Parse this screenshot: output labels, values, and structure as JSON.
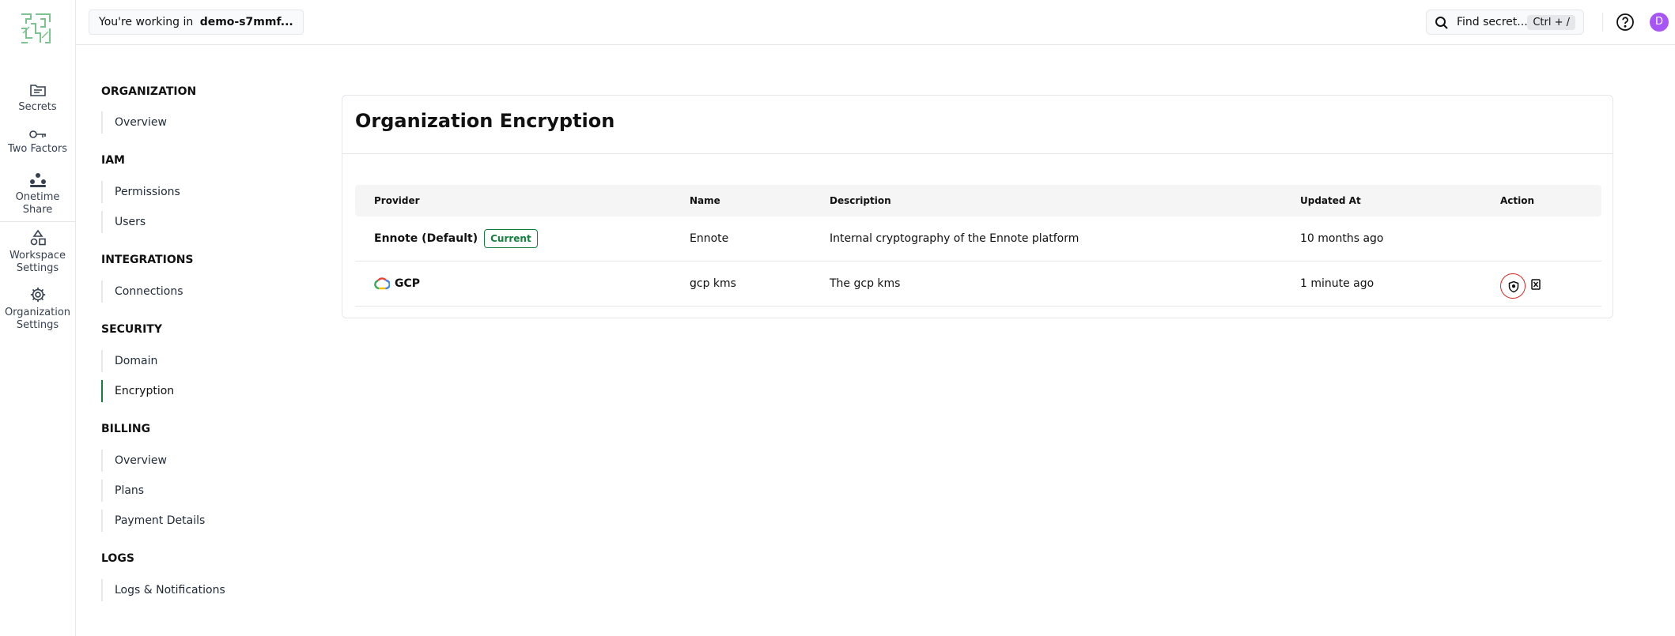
{
  "rail": {
    "items": [
      {
        "label": "Secrets",
        "icon": "folder-icon"
      },
      {
        "label": "Two Factors",
        "icon": "key-icon"
      },
      {
        "label": "Onetime",
        "label2": "Share",
        "icon": "share-nodes-icon"
      },
      {
        "label": "Workspace",
        "label2": "Settings",
        "icon": "shapes-icon"
      },
      {
        "label": "Organization",
        "label2": "Settings",
        "icon": "gear-icon"
      }
    ]
  },
  "topbar": {
    "workspace_prefix": "You're working in",
    "workspace_name": "demo-s7mmf...",
    "search_text": "Find secret...",
    "search_shortcut": "Ctrl + /",
    "avatar_initial": "D"
  },
  "settings_nav": {
    "organization": {
      "title": "ORGANIZATION",
      "items": [
        "Overview"
      ]
    },
    "iam": {
      "title": "IAM",
      "items": [
        "Permissions",
        "Users"
      ]
    },
    "integrations": {
      "title": "INTEGRATIONS",
      "items": [
        "Connections"
      ]
    },
    "security": {
      "title": "SECURITY",
      "items": [
        "Domain",
        "Encryption"
      ]
    },
    "billing": {
      "title": "BILLING",
      "items": [
        "Overview",
        "Plans",
        "Payment Details"
      ]
    },
    "logs": {
      "title": "LOGS",
      "items": [
        "Logs & Notifications"
      ]
    },
    "active_item": "Encryption"
  },
  "main": {
    "title": "Organization Encryption",
    "columns": [
      "Provider",
      "Name",
      "Description",
      "Updated At",
      "Action"
    ],
    "rows": [
      {
        "provider": "Ennote (Default)",
        "badge": "Current",
        "name": "Ennote",
        "description": "Internal cryptography of the Ennote platform",
        "updated": "10 months ago"
      },
      {
        "provider": "GCP",
        "name": "gcp kms",
        "description": "The gcp kms",
        "updated": "1 minute ago"
      }
    ]
  },
  "colors": {
    "accent_green": "#15803d",
    "avatar_purple": "#a855f7",
    "focus_ring_red": "#dc2626"
  }
}
